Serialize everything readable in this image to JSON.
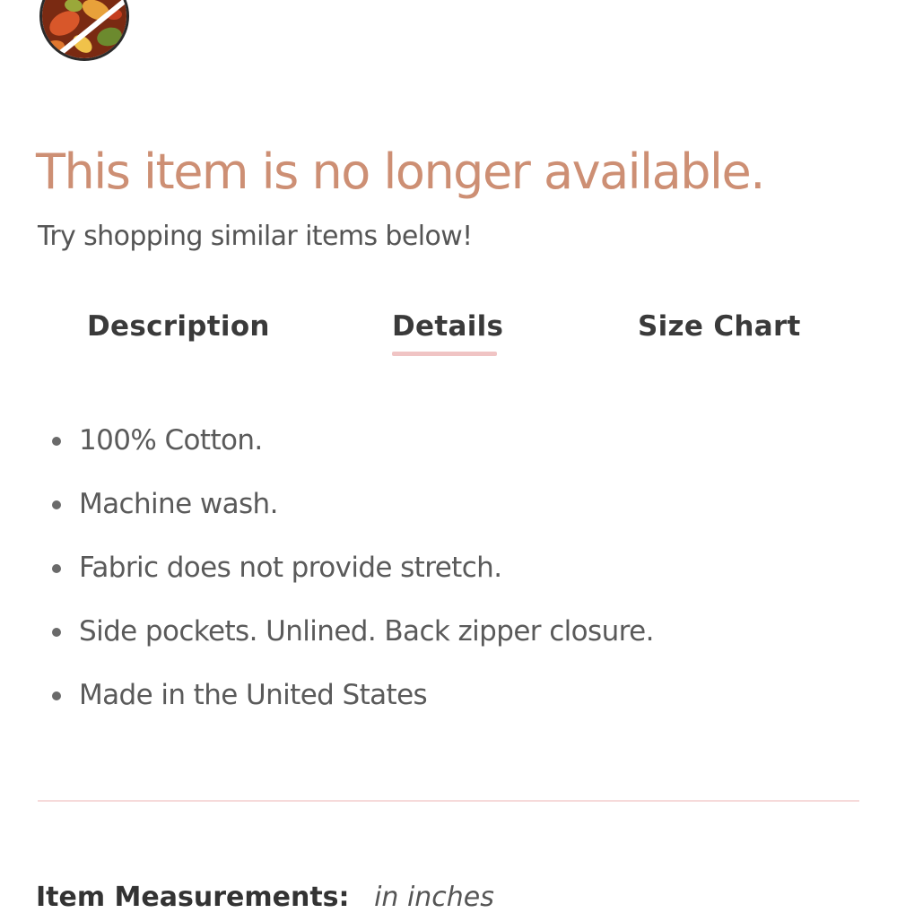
{
  "product": {
    "swatch_icon": "floral-swatch-icon",
    "unavailable_title": "This item is no longer available.",
    "unavailable_subtitle": "Try shopping similar items below!"
  },
  "tabs": [
    {
      "label": "Description",
      "active": false
    },
    {
      "label": "Details",
      "active": true
    },
    {
      "label": "Size Chart",
      "active": false
    }
  ],
  "details": [
    "100% Cotton.",
    "Machine wash.",
    "Fabric does not provide stretch.",
    "Side pockets. Unlined. Back zipper closure.",
    "Made in the United States"
  ],
  "measurements": {
    "label": "Item Measurements:",
    "unit": "in inches"
  },
  "colors": {
    "accent_title": "#cd8f74",
    "tab_underline": "#f0c4c4",
    "divider": "#f6dada",
    "text": "#5a5a5a"
  }
}
